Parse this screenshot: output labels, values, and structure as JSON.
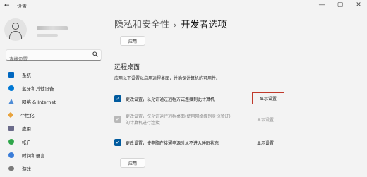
{
  "window": {
    "title": "设置",
    "back": "←",
    "minimize": "—",
    "maximize": "▢",
    "close": "✕"
  },
  "search": {
    "placeholder": "查找设置",
    "icon": "search-icon"
  },
  "sidebar": {
    "items": [
      {
        "label": "系统",
        "icon": "system-icon",
        "color": "#0067c0"
      },
      {
        "label": "蓝牙和其他设备",
        "icon": "bluetooth-icon",
        "color": "#0078d4"
      },
      {
        "label": "网络 & Internet",
        "icon": "network-icon",
        "color": "#4c8bd6"
      },
      {
        "label": "个性化",
        "icon": "personalization-icon",
        "color": "#e8a33d"
      },
      {
        "label": "应用",
        "icon": "apps-icon",
        "color": "#6b6b8a"
      },
      {
        "label": "帐户",
        "icon": "account-icon",
        "color": "#2fa64a"
      },
      {
        "label": "时间和语言",
        "icon": "time-language-icon",
        "color": "#3b7dd8"
      },
      {
        "label": "游戏",
        "icon": "gaming-icon",
        "color": "#7a7a7a"
      }
    ]
  },
  "breadcrumb": {
    "parent": "隐私和安全性",
    "separator": "›",
    "current": "开发者选项"
  },
  "top_apply": "应用",
  "remote_desktop": {
    "title": "远程桌面",
    "description": "应用以下设置以启用远程桌面，并确保计算机的可用性。",
    "rows": [
      {
        "label": "更改设置，以允许通过远程方式连接到此计算机",
        "link": "显示设置",
        "checked": "✓"
      },
      {
        "label_line1": "更改设置，仅允许运行远程桌面(使用网络级别身份验证)",
        "label_line2": "的计算机进行连接",
        "link": "显示设置",
        "checked": "✓"
      },
      {
        "label": "更改设置，使电脑在接通电源时从不进入睡眠状态",
        "link": "显示设置",
        "checked": "✓"
      }
    ],
    "apply": "应用"
  }
}
